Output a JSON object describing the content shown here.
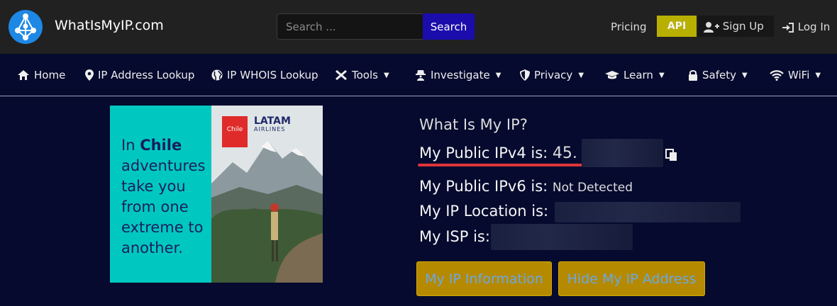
{
  "brand": {
    "name": "WhatIsMyIP.com"
  },
  "search": {
    "placeholder": "Search ...",
    "button_label": "Search"
  },
  "header_links": {
    "pricing": "Pricing",
    "api": "API",
    "signup": "Sign Up",
    "login": "Log In"
  },
  "nav": [
    {
      "label": "Home",
      "icon": "home-icon"
    },
    {
      "label": "IP Address Lookup",
      "icon": "map-pin-icon"
    },
    {
      "label": "IP WHOIS Lookup",
      "icon": "globe-icon"
    },
    {
      "label": "Tools",
      "icon": "tools-icon",
      "dropdown": true
    },
    {
      "label": "Investigate",
      "icon": "spy-icon",
      "dropdown": true
    },
    {
      "label": "Privacy",
      "icon": "shield-icon",
      "dropdown": true
    },
    {
      "label": "Learn",
      "icon": "graduation-cap-icon",
      "dropdown": true
    },
    {
      "label": "Safety",
      "icon": "lock-icon",
      "dropdown": true
    },
    {
      "label": "WiFi",
      "icon": "wifi-icon",
      "dropdown": true
    }
  ],
  "ad": {
    "text_prefix": "In ",
    "text_bold": "Chile",
    "text_rest": "adventures take you from one extreme to another.",
    "brand_logo_text": "Chile",
    "airline_name": "LATAM",
    "airline_sub": "AIRLINES"
  },
  "ip_info": {
    "title": "What Is My IP?",
    "ipv4_label": "My Public IPv4 is:",
    "ipv4_value": "45.",
    "ipv6_label": "My Public IPv6 is:",
    "ipv6_value": "Not Detected",
    "location_label": "My IP Location is:",
    "isp_label": "My ISP is:"
  },
  "buttons": {
    "info": "My IP Information",
    "hide": "Hide My IP Address"
  },
  "colors": {
    "topbar": "#212121",
    "page_bg": "#050a2e",
    "search_button": "#1a0dab",
    "api_badge": "#b8b000",
    "action_button": "#b58a00",
    "underline": "#e0343a"
  }
}
